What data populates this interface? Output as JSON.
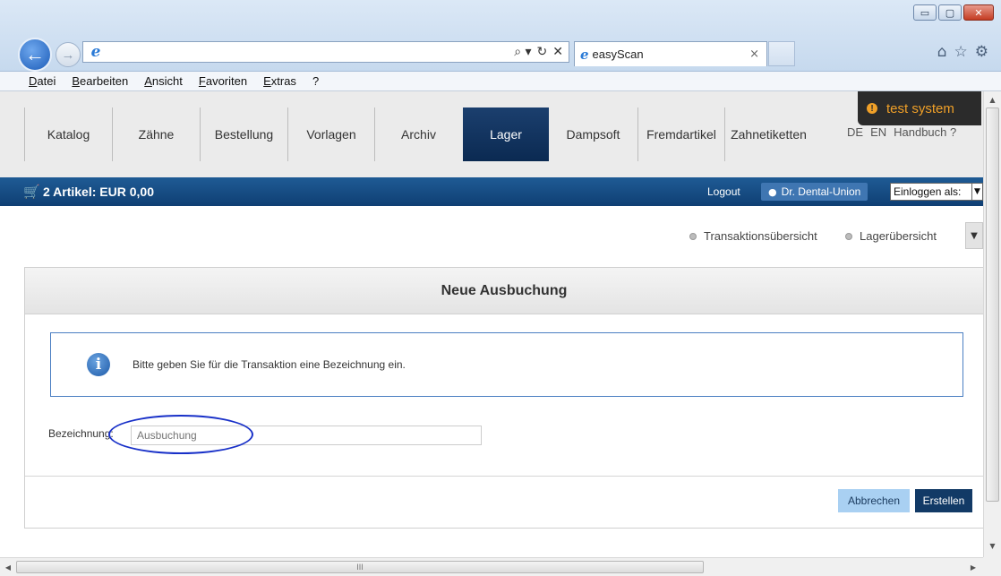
{
  "browser": {
    "address_value": "",
    "tab_title": "easyScan",
    "tab_close": "×",
    "addr_tools": [
      "⌕ ▾",
      "↻",
      "✕"
    ],
    "win_controls": [
      "▭",
      "▢",
      "✕"
    ],
    "right_icons": [
      "⌂",
      "☆",
      "⚙"
    ]
  },
  "menubar": [
    "Datei",
    "Bearbeiten",
    "Ansicht",
    "Favoriten",
    "Extras",
    "?"
  ],
  "appnav": {
    "items": [
      "Katalog",
      "Zähne",
      "Bestellung",
      "Vorlagen",
      "Archiv",
      "Lager",
      "Dampsoft",
      "Fremdartikel",
      "Zahnetiketten"
    ],
    "active": "Lager",
    "lang": [
      "DE",
      "EN",
      "Handbuch ?"
    ]
  },
  "banner": {
    "text": "test system",
    "icon": "!"
  },
  "cartbar": {
    "cart_text": "2 Artikel: EUR 0,00",
    "logout": "Logout",
    "user": "Dr. Dental-Union",
    "login_as": "Einloggen als:"
  },
  "sublinks": [
    "Transaktionsübersicht",
    "Lagerübersicht"
  ],
  "panel": {
    "title": "Neue Ausbuchung",
    "info_text": "Bitte geben Sie für die Transaktion eine Bezeichnung ein.",
    "field_label": "Bezeichnung:",
    "field_placeholder": "Ausbuchung",
    "cancel_label": "Abbrechen",
    "create_label": "Erstellen"
  },
  "scroll": {
    "hthumb_grip": "III"
  },
  "colors": {
    "nav_active": "#0b2a52",
    "cartbar": "#1a4f86",
    "banner_text": "#f0a028",
    "create_button": "#123a66",
    "cancel_button": "#a9d0f2",
    "annotation": "#1830c8"
  }
}
